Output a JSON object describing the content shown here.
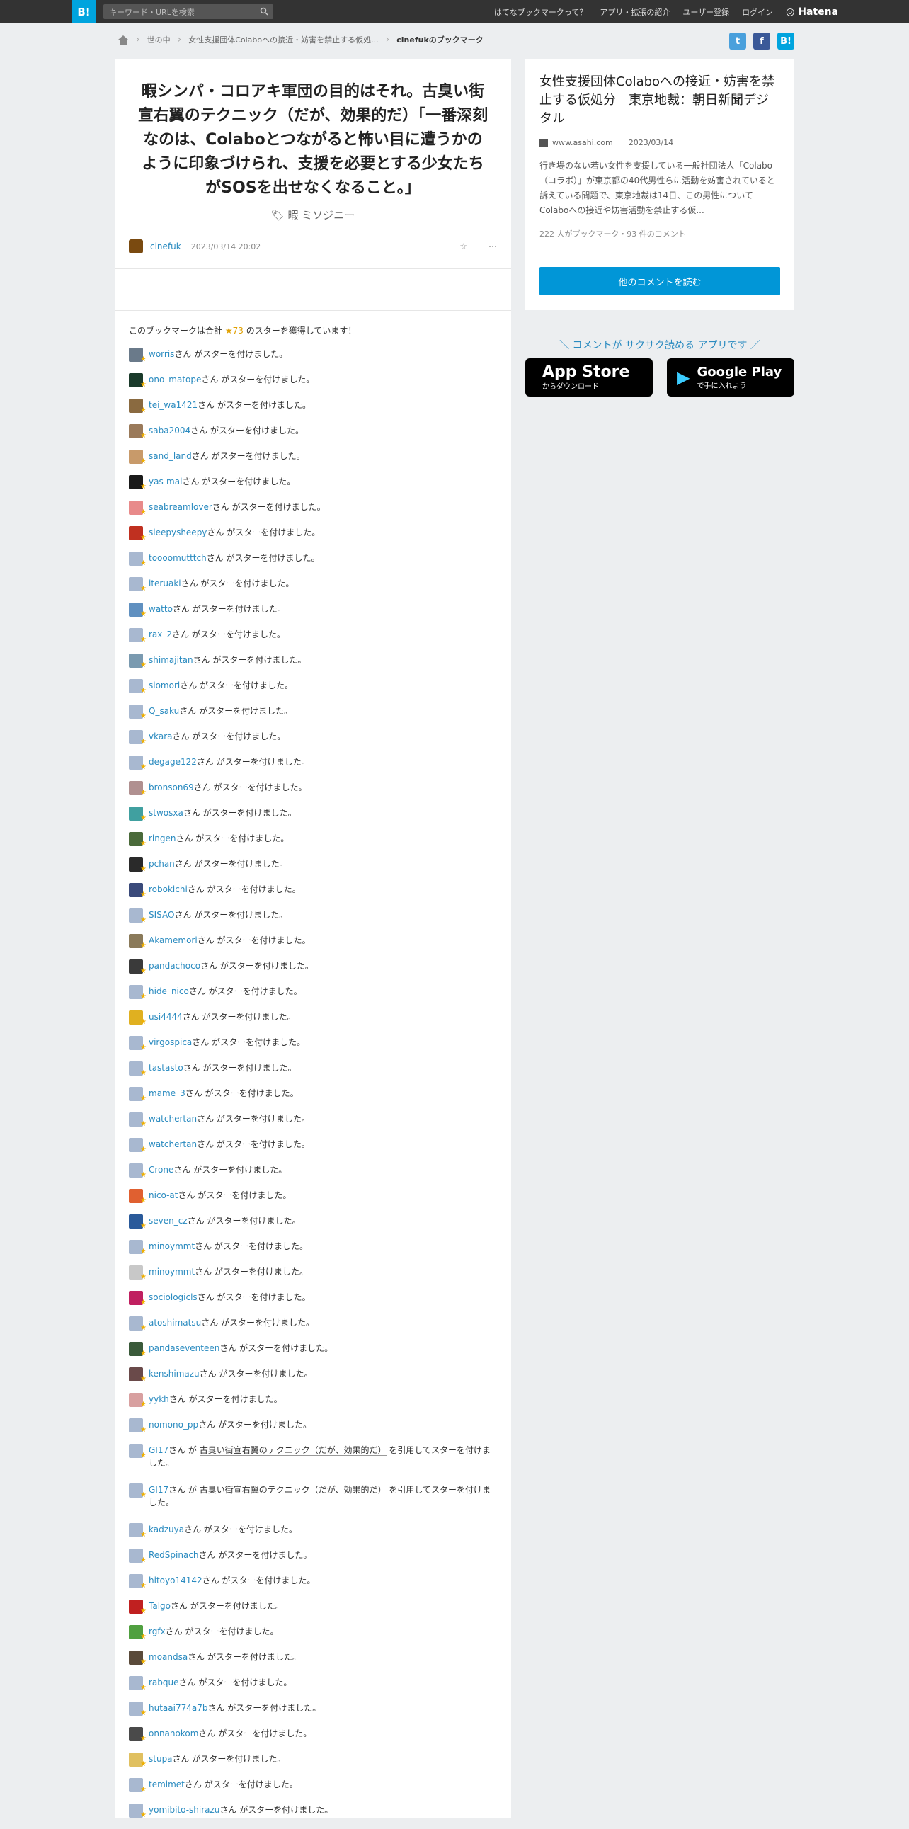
{
  "header": {
    "logo": "B!",
    "search_placeholder": "キーワード・URLを検索",
    "nav": [
      "はてなブックマークって？",
      "アプリ・拡張の紹介",
      "ユーザー登録",
      "ログイン"
    ],
    "hatena": "Hatena"
  },
  "breadcrumb": {
    "cat": "世の中",
    "article": "女性支援団体Colaboへの接近・妨害を禁止する仮処...",
    "current": "cinefukのブックマーク"
  },
  "share": {
    "tw": "t",
    "fb": "f",
    "hb": "B!"
  },
  "bookmark": {
    "comment": "暇シンパ・コロアキ軍団の目的はそれ。古臭い街宣右翼のテクニック（だが、効果的だ）「一番深刻なのは、Colaboとつながると怖い目に遭うかのように印象づけられ、支援を必要とする少女たちがSOSを出せなくなること。」",
    "tags": "暇 ミソジニー",
    "user": "cinefuk",
    "date": "2023/03/14 20:02",
    "more": "⋯"
  },
  "stars": {
    "head_pre": "このブックマークは合計",
    "count": "★73",
    "head_post": "のスターを獲得しています！",
    "suffix": "さん がスターを付けました。",
    "items": [
      {
        "u": "worris",
        "c": "#6a7a8a"
      },
      {
        "u": "ono_matope",
        "c": "#1a3a2a"
      },
      {
        "u": "tei_wa1421",
        "c": "#8a6a40"
      },
      {
        "u": "saba2004",
        "c": "#9a7a5a"
      },
      {
        "u": "sand_land",
        "c": "#c89a6a"
      },
      {
        "u": "yas-mal",
        "c": "#1a1a1a"
      },
      {
        "u": "seabreamlover",
        "c": "#e88a8a"
      },
      {
        "u": "sleepysheepy",
        "c": "#c03020"
      },
      {
        "u": "toooomutttch",
        "c": "#a8b8d0"
      },
      {
        "u": "iteruaki",
        "c": "#a8b8d0"
      },
      {
        "u": "watto",
        "c": "#6090c0"
      },
      {
        "u": "rax_2",
        "c": "#a8b8d0"
      },
      {
        "u": "shimajitan",
        "c": "#7a9ab0"
      },
      {
        "u": "siomori",
        "c": "#a8b8d0"
      },
      {
        "u": "Q_saku",
        "c": "#a8b8d0"
      },
      {
        "u": "vkara",
        "c": "#a8b8d0"
      },
      {
        "u": "degage122",
        "c": "#a8b8d0"
      },
      {
        "u": "bronson69",
        "c": "#b09090"
      },
      {
        "u": "stwosxa",
        "c": "#40a0a0"
      },
      {
        "u": "ringen",
        "c": "#4a6a3a"
      },
      {
        "u": "pchan",
        "c": "#2a2a2a"
      },
      {
        "u": "robokichi",
        "c": "#3a4a7a"
      },
      {
        "u": "SISAO",
        "c": "#a8b8d0"
      },
      {
        "u": "Akamemori",
        "c": "#8a7a5a"
      },
      {
        "u": "pandachoco",
        "c": "#3a3a3a"
      },
      {
        "u": "hide_nico",
        "c": "#a8b8d0"
      },
      {
        "u": "usi4444",
        "c": "#e0b020"
      },
      {
        "u": "virgospica",
        "c": "#a8b8d0"
      },
      {
        "u": "tastasto",
        "c": "#a8b8d0"
      },
      {
        "u": "mame_3",
        "c": "#a8b8d0"
      },
      {
        "u": "watchertan",
        "c": "#a8b8d0"
      },
      {
        "u": "watchertan",
        "c": "#a8b8d0"
      },
      {
        "u": "Crone",
        "c": "#a8b8d0"
      },
      {
        "u": "nico-at",
        "c": "#e06030"
      },
      {
        "u": "seven_cz",
        "c": "#2a5a9a"
      },
      {
        "u": "minoymmt",
        "c": "#a8b8d0"
      },
      {
        "u": "minoymmt",
        "c": "#c8c8c8"
      },
      {
        "u": "sociologicls",
        "c": "#c02060"
      },
      {
        "u": "atoshimatsu",
        "c": "#a8b8d0"
      },
      {
        "u": "pandaseventeen",
        "c": "#3a5a3a"
      },
      {
        "u": "kenshimazu",
        "c": "#6a4a4a"
      },
      {
        "u": "yykh",
        "c": "#d8a0a0"
      },
      {
        "u": "nomono_pp",
        "c": "#a8b8d0"
      },
      {
        "u": "GI17",
        "quote": "古臭い街宣右翼のテクニック（だが、効果的だ）",
        "quote_suffix": "を引用してスターを付けました。",
        "c": "#a8b8d0"
      },
      {
        "u": "GI17",
        "quote": "古臭い街宣右翼のテクニック（だが、効果的だ）",
        "quote_suffix": "を引用してスターを付けました。",
        "c": "#a8b8d0"
      },
      {
        "u": "kadzuya",
        "c": "#a8b8d0"
      },
      {
        "u": "RedSpinach",
        "c": "#a8b8d0"
      },
      {
        "u": "hitoyo14142",
        "c": "#a8b8d0"
      },
      {
        "u": "Talgo",
        "c": "#c02020"
      },
      {
        "u": "rgfx",
        "c": "#50a040"
      },
      {
        "u": "moandsa",
        "c": "#5a4a3a"
      },
      {
        "u": "rabque",
        "c": "#a8b8d0"
      },
      {
        "u": "hutaai774a7b",
        "c": "#a8b8d0"
      },
      {
        "u": "onnanokom",
        "c": "#4a4a4a"
      },
      {
        "u": "stupa",
        "c": "#e0c060"
      },
      {
        "u": "temimet",
        "c": "#a8b8d0"
      },
      {
        "u": "yomibito-shirazu",
        "c": "#a8b8d0"
      }
    ]
  },
  "entry": {
    "title": "女性支援団体Colaboへの接近・妨害を禁止する仮処分　東京地裁：朝日新聞デジタル",
    "domain": "www.asahi.com",
    "date": "2023/03/14",
    "desc": "行き場のない若い女性を支援している一般社団法人「Colabo（コラボ）」が東京都の40代男性らに活動を妨害されていると訴えている問題で、東京地裁は14日、この男性についてColaboへの接近や妨害活動を禁止する仮...",
    "count": "222 人がブックマーク・93 件のコメント",
    "button": "他のコメントを読む"
  },
  "promo": {
    "text": "＼ コメントが サクサク読める アプリです ／",
    "appstore_big": "App Store",
    "appstore_small": "からダウンロード",
    "gplay_big": "Google Play",
    "gplay_small": "で手に入れよう"
  }
}
